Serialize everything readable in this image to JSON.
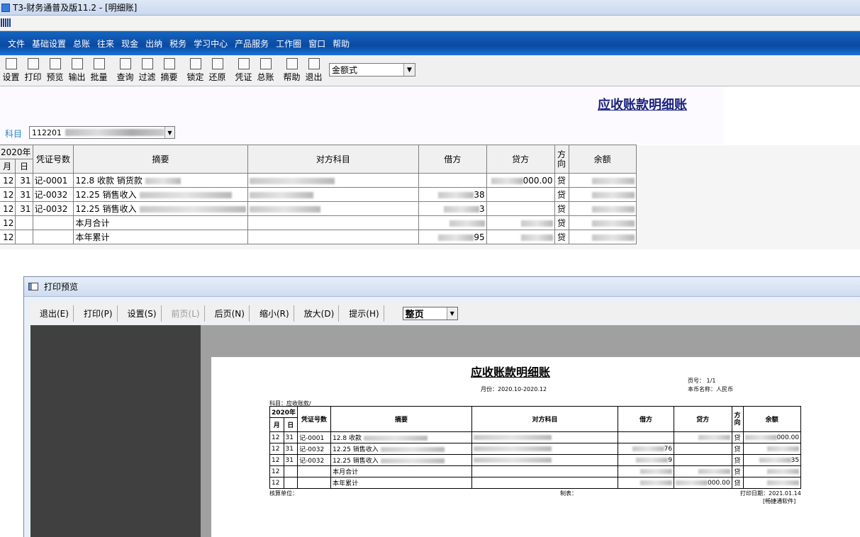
{
  "window": {
    "title": "T3-财务通普及版11.2 - [明细账]"
  },
  "menu": [
    "文件",
    "基础设置",
    "总账",
    "往来",
    "现金",
    "出纳",
    "税务",
    "学习中心",
    "产品服务",
    "工作圈",
    "窗口",
    "帮助"
  ],
  "toolbar": {
    "buttons": [
      {
        "label": "设置",
        "icon": "settings-icon"
      },
      {
        "label": "打印",
        "icon": "print-icon"
      },
      {
        "label": "预览",
        "icon": "preview-icon"
      },
      {
        "label": "输出",
        "icon": "export-icon"
      },
      {
        "label": "批量",
        "icon": "batch-icon"
      },
      {
        "label": "查询",
        "icon": "binoculars-icon"
      },
      {
        "label": "过滤",
        "icon": "filter-icon"
      },
      {
        "label": "摘要",
        "icon": "summary-icon"
      },
      {
        "label": "锁定",
        "icon": "lock-icon"
      },
      {
        "label": "还原",
        "icon": "restore-icon"
      },
      {
        "label": "凭证",
        "icon": "voucher-icon"
      },
      {
        "label": "总账",
        "icon": "ledger-icon"
      },
      {
        "label": "帮助",
        "icon": "help-icon"
      },
      {
        "label": "退出",
        "icon": "exit-icon"
      }
    ],
    "format_select": "金额式"
  },
  "report": {
    "title": "应收账款明细账",
    "subject_label": "科目",
    "subject_value": "112201",
    "headers": {
      "year": "2020年",
      "month": "月",
      "day": "日",
      "voucher": "凭证号数",
      "summary": "摘要",
      "counter": "对方科目",
      "debit": "借方",
      "credit": "贷方",
      "direction": "方向",
      "balance": "余额"
    },
    "rows": [
      {
        "m": "12",
        "d": "31",
        "voucher": "记-0001",
        "summary": "12.8 收款 销货款",
        "debit": "",
        "credit": "000.00",
        "dir": "贷"
      },
      {
        "m": "12",
        "d": "31",
        "voucher": "记-0032",
        "summary": "12.25 销售收入",
        "debit": "38",
        "credit": "",
        "dir": "贷"
      },
      {
        "m": "12",
        "d": "31",
        "voucher": "记-0032",
        "summary": "12.25 销售收入",
        "debit": "3",
        "credit": "",
        "dir": "贷"
      },
      {
        "m": "12",
        "d": "",
        "voucher": "",
        "summary": "本月合计",
        "debit": "",
        "credit": "",
        "dir": "贷"
      },
      {
        "m": "12",
        "d": "",
        "voucher": "",
        "summary": "本年累计",
        "debit": "95",
        "credit": "",
        "dir": "贷"
      }
    ]
  },
  "preview": {
    "title": "打印预览",
    "buttons": [
      {
        "label": "退出(E)",
        "disabled": false
      },
      {
        "label": "打印(P)",
        "disabled": false
      },
      {
        "label": "设置(S)",
        "disabled": false
      },
      {
        "label": "前页(L)",
        "disabled": true
      },
      {
        "label": "后页(N)",
        "disabled": false
      },
      {
        "label": "缩小(R)",
        "disabled": false
      },
      {
        "label": "放大(D)",
        "disabled": false
      },
      {
        "label": "提示(H)",
        "disabled": false
      }
    ],
    "zoom_select": "整页",
    "paper": {
      "title": "应收账款明细账",
      "period": "月份：2020.10-2020.12",
      "page_no": "页号：    1/1",
      "currency": "本币名称：人民币",
      "subject": "科目：应收账款/",
      "unit": "核算单位：",
      "maker": "制表：",
      "print_date": "打印日期：2021.01.14",
      "brand": "[畅捷通软件]",
      "rows": [
        {
          "m": "12",
          "d": "31",
          "voucher": "记-0001",
          "summary": "12.8 收款",
          "debit": "",
          "credit": "",
          "dir": "贷",
          "balance": "000.00"
        },
        {
          "m": "12",
          "d": "31",
          "voucher": "记-0032",
          "summary": "12.25 销售收入",
          "debit": "76",
          "credit": "",
          "dir": "贷",
          "balance": ""
        },
        {
          "m": "12",
          "d": "31",
          "voucher": "记-0032",
          "summary": "12.25 销售收入",
          "debit": "9",
          "credit": "",
          "dir": "贷",
          "balance": "35"
        },
        {
          "m": "12",
          "d": "",
          "voucher": "",
          "summary": "本月合计",
          "debit": "",
          "credit": "",
          "dir": "贷",
          "balance": ""
        },
        {
          "m": "12",
          "d": "",
          "voucher": "",
          "summary": "本年累计",
          "debit": "",
          "credit": "000.00",
          "dir": "贷",
          "balance": ""
        }
      ]
    }
  }
}
